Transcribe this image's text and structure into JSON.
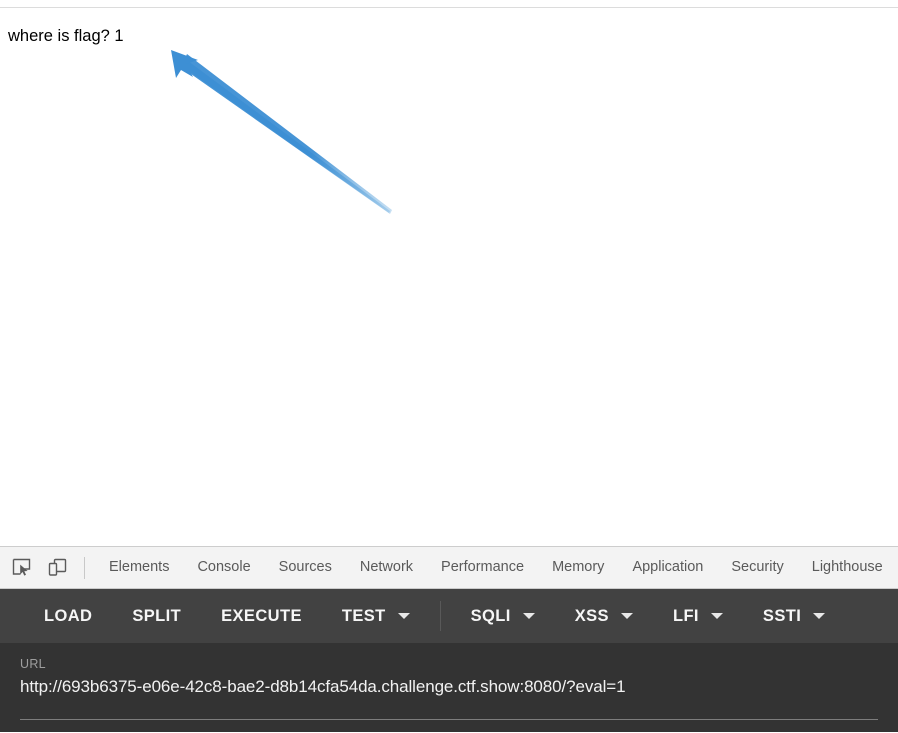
{
  "page": {
    "body_text": "where is flag? 1",
    "annotation": {
      "name": "blue-arrow-annotation",
      "color": "#3d8fd4",
      "points_to": "where is flag? 1"
    }
  },
  "devtools": {
    "inspect_icon": "inspect-element-icon",
    "device_icon": "device-toolbar-icon",
    "tabs": [
      {
        "label": "Elements"
      },
      {
        "label": "Console"
      },
      {
        "label": "Sources"
      },
      {
        "label": "Network"
      },
      {
        "label": "Performance"
      },
      {
        "label": "Memory"
      },
      {
        "label": "Application"
      },
      {
        "label": "Security"
      },
      {
        "label": "Lighthouse"
      }
    ]
  },
  "action_bar": {
    "buttons": [
      {
        "label": "LOAD",
        "has_caret": false
      },
      {
        "label": "SPLIT",
        "has_caret": false
      },
      {
        "label": "EXECUTE",
        "has_caret": false
      },
      {
        "label": "TEST",
        "has_caret": true
      }
    ],
    "payload_menus": [
      {
        "label": "SQLI",
        "has_caret": true
      },
      {
        "label": "XSS",
        "has_caret": true
      },
      {
        "label": "LFI",
        "has_caret": true
      },
      {
        "label": "SSTI",
        "has_caret": true
      }
    ]
  },
  "url_panel": {
    "label": "URL",
    "value": "http://693b6375-e06e-42c8-bae2-d8b14cfa54da.challenge.ctf.show:8080/?eval=1"
  },
  "colors": {
    "toolbar_bg": "#424242",
    "url_panel_bg": "#333333",
    "tabs_bg": "#f3f3f3",
    "arrow": "#3d8fd4"
  }
}
